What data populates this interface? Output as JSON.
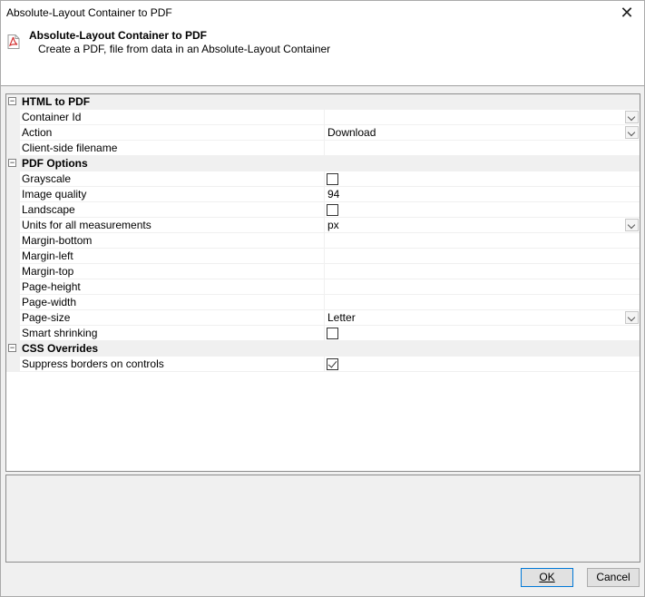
{
  "window": {
    "title": "Absolute-Layout Container to PDF"
  },
  "header": {
    "title": "Absolute-Layout Container to PDF",
    "description": "Create a PDF, file from data in an Absolute-Layout Container",
    "icon": "pdf-file-icon"
  },
  "grid": {
    "categories": [
      {
        "label": "HTML to PDF",
        "expander": "⊟",
        "rows": [
          {
            "name": "Container Id",
            "value": "",
            "editor": "dropdown"
          },
          {
            "name": "Action",
            "value": "Download",
            "editor": "dropdown"
          },
          {
            "name": "Client-side filename",
            "value": "",
            "editor": "text"
          }
        ]
      },
      {
        "label": "PDF Options",
        "expander": "⊟",
        "rows": [
          {
            "name": "Grayscale",
            "value": "",
            "editor": "checkbox",
            "checked": false
          },
          {
            "name": "Image quality",
            "value": "94",
            "editor": "text"
          },
          {
            "name": "Landscape",
            "value": "",
            "editor": "checkbox",
            "checked": false
          },
          {
            "name": "Units for all measurements",
            "value": "px",
            "editor": "dropdown"
          },
          {
            "name": "Margin-bottom",
            "value": "",
            "editor": "text"
          },
          {
            "name": "Margin-left",
            "value": "",
            "editor": "text"
          },
          {
            "name": "Margin-top",
            "value": "",
            "editor": "text"
          },
          {
            "name": "Page-height",
            "value": "",
            "editor": "text"
          },
          {
            "name": "Page-width",
            "value": "",
            "editor": "text"
          },
          {
            "name": "Page-size",
            "value": "Letter",
            "editor": "dropdown"
          },
          {
            "name": "Smart shrinking",
            "value": "",
            "editor": "checkbox",
            "checked": false
          }
        ]
      },
      {
        "label": "CSS Overrides",
        "expander": "⊟",
        "rows": [
          {
            "name": "Suppress borders on controls",
            "value": "",
            "editor": "checkbox",
            "checked": true
          }
        ]
      }
    ]
  },
  "buttons": {
    "ok": "OK",
    "cancel": "Cancel"
  },
  "colors": {
    "accent": "#0078d7",
    "pdf_red": "#d32f2f"
  }
}
